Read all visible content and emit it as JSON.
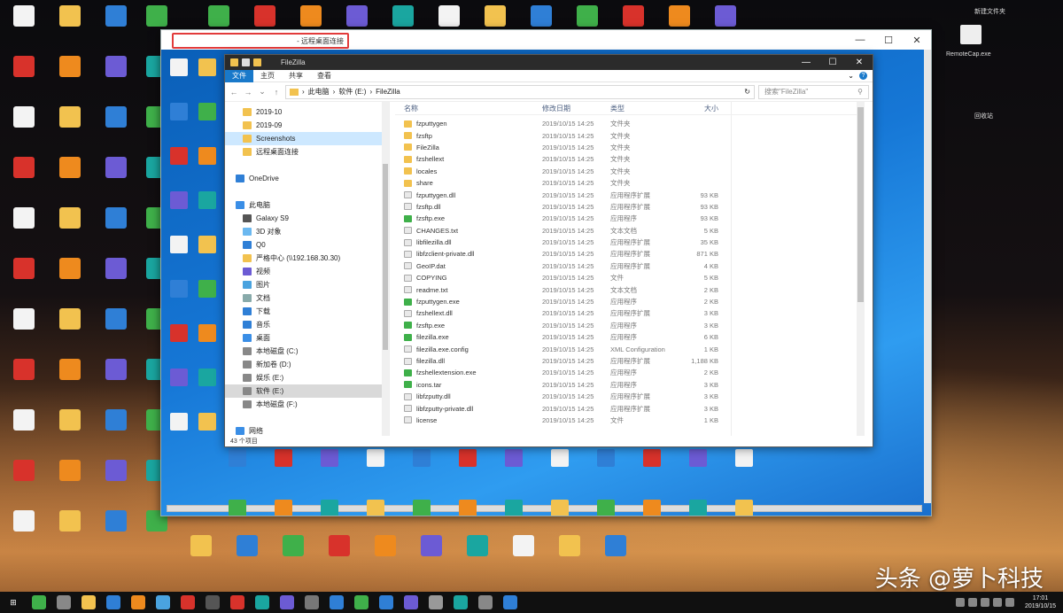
{
  "desktop": {
    "watermark": "头条 @萝卜科技"
  },
  "outer_window": {
    "title": "- 远程桌面连接",
    "min": "—",
    "max": "☐",
    "close": "✕"
  },
  "explorer": {
    "title": "FileZilla",
    "tabs": [
      "文件",
      "主页",
      "共享",
      "查看"
    ],
    "address": [
      "此电脑",
      "软件 (E:)",
      "FileZilla"
    ],
    "search_placeholder": "搜索\"FileZilla\"",
    "controls": {
      "min": "—",
      "max": "☐",
      "close": "✕"
    },
    "columns": {
      "name": "名称",
      "date": "修改日期",
      "type": "类型",
      "size": "大小"
    },
    "nav": [
      {
        "label": "2019-10",
        "kind": "folder",
        "sel": ""
      },
      {
        "label": "2019-09",
        "kind": "folder",
        "sel": ""
      },
      {
        "label": "Screenshots",
        "kind": "folder",
        "sel": "sel"
      },
      {
        "label": "远程桌面连接",
        "kind": "folder",
        "sel": ""
      },
      {
        "label": "",
        "kind": "blank",
        "sel": ""
      },
      {
        "label": "OneDrive",
        "kind": "cloud",
        "sel": ""
      },
      {
        "label": "",
        "kind": "blank",
        "sel": ""
      },
      {
        "label": "此电脑",
        "kind": "pc",
        "sel": ""
      },
      {
        "label": "Galaxy S9",
        "kind": "phone",
        "sel": ""
      },
      {
        "label": "3D 对象",
        "kind": "obj",
        "sel": ""
      },
      {
        "label": "Q0",
        "kind": "blue",
        "sel": ""
      },
      {
        "label": "严格中心 (\\\\192.168.30.30)",
        "kind": "folder",
        "sel": ""
      },
      {
        "label": "视频",
        "kind": "video",
        "sel": ""
      },
      {
        "label": "图片",
        "kind": "pic",
        "sel": ""
      },
      {
        "label": "文档",
        "kind": "doc",
        "sel": ""
      },
      {
        "label": "下载",
        "kind": "down",
        "sel": ""
      },
      {
        "label": "音乐",
        "kind": "music",
        "sel": ""
      },
      {
        "label": "桌面",
        "kind": "desk",
        "sel": ""
      },
      {
        "label": "本地磁盘 (C:)",
        "kind": "drive",
        "sel": ""
      },
      {
        "label": "新加卷 (D:)",
        "kind": "drive",
        "sel": ""
      },
      {
        "label": "娱乐 (E:)",
        "kind": "drive",
        "sel": ""
      },
      {
        "label": "软件 (E:)",
        "kind": "drive",
        "sel": "sel2"
      },
      {
        "label": "本地磁盘 (F:)",
        "kind": "drive",
        "sel": ""
      },
      {
        "label": "",
        "kind": "blank",
        "sel": ""
      },
      {
        "label": "网络",
        "kind": "net",
        "sel": ""
      }
    ],
    "files": [
      {
        "name": "fzputtygen",
        "date": "2019/10/15 14:25",
        "type": "文件夹",
        "size": "",
        "kind": "folder"
      },
      {
        "name": "fzsftp",
        "date": "2019/10/15 14:25",
        "type": "文件夹",
        "size": "",
        "kind": "folder"
      },
      {
        "name": "FileZilla",
        "date": "2019/10/15 14:25",
        "type": "文件夹",
        "size": "",
        "kind": "folder"
      },
      {
        "name": "fzshellext",
        "date": "2019/10/15 14:25",
        "type": "文件夹",
        "size": "",
        "kind": "folder"
      },
      {
        "name": "locales",
        "date": "2019/10/15 14:25",
        "type": "文件夹",
        "size": "",
        "kind": "folder"
      },
      {
        "name": "share",
        "date": "2019/10/15 14:25",
        "type": "文件夹",
        "size": "",
        "kind": "folder"
      },
      {
        "name": "fzputtygen.dll",
        "date": "2019/10/15 14:25",
        "type": "应用程序扩展",
        "size": "93 KB",
        "kind": "file"
      },
      {
        "name": "fzsftp.dll",
        "date": "2019/10/15 14:25",
        "type": "应用程序扩展",
        "size": "93 KB",
        "kind": "file"
      },
      {
        "name": "fzsftp.exe",
        "date": "2019/10/15 14:25",
        "type": "应用程序",
        "size": "93 KB",
        "kind": "exe"
      },
      {
        "name": "CHANGES.txt",
        "date": "2019/10/15 14:25",
        "type": "文本文档",
        "size": "5 KB",
        "kind": "file"
      },
      {
        "name": "libfilezilla.dll",
        "date": "2019/10/15 14:25",
        "type": "应用程序扩展",
        "size": "35 KB",
        "kind": "file"
      },
      {
        "name": "libfzclient-private.dll",
        "date": "2019/10/15 14:25",
        "type": "应用程序扩展",
        "size": "871 KB",
        "kind": "file"
      },
      {
        "name": "GeoIP.dat",
        "date": "2019/10/15 14:25",
        "type": "应用程序扩展",
        "size": "4 KB",
        "kind": "file"
      },
      {
        "name": "COPYING",
        "date": "2019/10/15 14:25",
        "type": "文件",
        "size": "5 KB",
        "kind": "file"
      },
      {
        "name": "readme.txt",
        "date": "2019/10/15 14:25",
        "type": "文本文档",
        "size": "2 KB",
        "kind": "file"
      },
      {
        "name": "fzputtygen.exe",
        "date": "2019/10/15 14:25",
        "type": "应用程序",
        "size": "2 KB",
        "kind": "exe"
      },
      {
        "name": "fzshellext.dll",
        "date": "2019/10/15 14:25",
        "type": "应用程序扩展",
        "size": "3 KB",
        "kind": "file"
      },
      {
        "name": "fzsftp.exe",
        "date": "2019/10/15 14:25",
        "type": "应用程序",
        "size": "3 KB",
        "kind": "exe"
      },
      {
        "name": "filezilla.exe",
        "date": "2019/10/15 14:25",
        "type": "应用程序",
        "size": "6 KB",
        "kind": "exe"
      },
      {
        "name": "filezilla.exe.config",
        "date": "2019/10/15 14:25",
        "type": "XML Configuration",
        "size": "1 KB",
        "kind": "file"
      },
      {
        "name": "filezilla.dll",
        "date": "2019/10/15 14:25",
        "type": "应用程序扩展",
        "size": "1,188 KB",
        "kind": "file"
      },
      {
        "name": "fzshellextension.exe",
        "date": "2019/10/15 14:25",
        "type": "应用程序",
        "size": "2 KB",
        "kind": "exe"
      },
      {
        "name": "icons.tar",
        "date": "2019/10/15 14:25",
        "type": "应用程序",
        "size": "3 KB",
        "kind": "exe"
      },
      {
        "name": "libfzputty.dll",
        "date": "2019/10/15 14:25",
        "type": "应用程序扩展",
        "size": "3 KB",
        "kind": "file"
      },
      {
        "name": "libfzputty-private.dll",
        "date": "2019/10/15 14:25",
        "type": "应用程序扩展",
        "size": "3 KB",
        "kind": "file"
      },
      {
        "name": "license",
        "date": "2019/10/15 14:25",
        "type": "文件",
        "size": "1 KB",
        "kind": "file"
      }
    ],
    "status": "43 个项目"
  },
  "desktop_right": {
    "top_label": "新建文件夹",
    "label2": "RemoteCap.exe",
    "label3": "回收站"
  },
  "taskbar": {
    "clock_time": "17:01",
    "clock_date": "2019/10/15"
  },
  "colors": {
    "accent": "#1979ca",
    "highlight_box": "#e23b3b",
    "folder": "#f2c24f",
    "remote_bg": "#1677d6"
  }
}
